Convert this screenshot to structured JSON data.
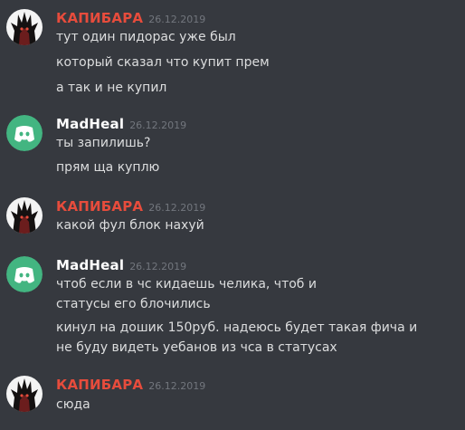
{
  "colors": {
    "background": "#36393f",
    "text": "#dcddde",
    "timestamp": "#72767d",
    "kapibara_name": "#e74c3c",
    "madheal_name": "#ffffff",
    "discord_blurple": "#43b581"
  },
  "messages": [
    {
      "author": "КАПИБАРА",
      "timestamp": "26.12.2019",
      "avatar_icon": "dark-spiky-avatar",
      "lines": [
        "тут один пидорас уже был",
        "который сказал что купит прем",
        "а так и не купил"
      ]
    },
    {
      "author": "MadHeal",
      "timestamp": "26.12.2019",
      "avatar_icon": "discord-default-avatar",
      "lines": [
        "ты запилишь?",
        "прям ща куплю"
      ]
    },
    {
      "author": "КАПИБАРА",
      "timestamp": "26.12.2019",
      "avatar_icon": "dark-spiky-avatar",
      "lines": [
        "какой фул блок нахуй"
      ]
    },
    {
      "author": "MadHeal",
      "timestamp": "26.12.2019",
      "avatar_icon": "discord-default-avatar",
      "lines": [
        "чтоб если в чс кидаешь челика, чтоб и статусы его блочились",
        "кинул на дошик 150руб. надеюсь будет такая фича и не буду видеть уебанов из чса в статусах"
      ]
    },
    {
      "author": "КАПИБАРА",
      "timestamp": "26.12.2019",
      "avatar_icon": "dark-spiky-avatar",
      "lines": [
        "сюда"
      ]
    }
  ]
}
